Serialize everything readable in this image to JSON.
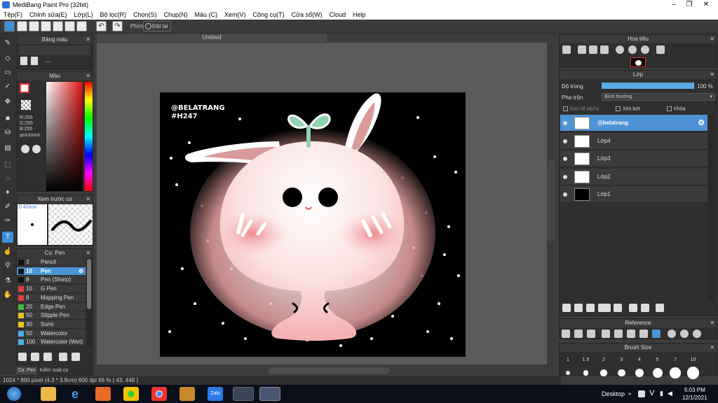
{
  "window": {
    "title": "MediBang Paint Pro (32bit)"
  },
  "menu": [
    "Tệp(F)",
    "Chỉnh sửa(E)",
    "Lớp(L)",
    "Bộ lọc(R)",
    "Chọn(S)",
    "Chụp(N)",
    "Màu (C)",
    "Xem(V)",
    "Công cụ(T)",
    "Cửa sổ(W)",
    "Cloud",
    "Help"
  ],
  "toolbar": {
    "key_label": "Phím",
    "reset_label": "Đặt lại"
  },
  "document": {
    "tab_title": "Untitled"
  },
  "panels": {
    "palette": {
      "title": "Bảng màu",
      "placeholder": "---"
    },
    "color": {
      "title": "Màu",
      "r": "R:255",
      "g": "G:255",
      "b": "B:255",
      "hex": "#FFFFFF"
    },
    "brush_preview": {
      "title": "Xem trước cọ",
      "size": "0.42mm"
    },
    "brush": {
      "title": "Cọ: Pen",
      "items": [
        {
          "size": "3",
          "name": "Pencil",
          "color": "#111111"
        },
        {
          "size": "10",
          "name": "Pen",
          "color": "#111111",
          "selected": true
        },
        {
          "size": "8",
          "name": "Pen (Sharp)",
          "color": "#111111"
        },
        {
          "size": "10",
          "name": "G Pen",
          "color": "#e53b3b"
        },
        {
          "size": "8",
          "name": "Mapping Pen",
          "color": "#e53b3b"
        },
        {
          "size": "20",
          "name": "Edge Pen",
          "color": "#3cbf3c"
        },
        {
          "size": "50",
          "name": "Stipple Pen",
          "color": "#e8c21f"
        },
        {
          "size": "30",
          "name": "Sumi",
          "color": "#e8c21f"
        },
        {
          "size": "50",
          "name": "Watercolor",
          "color": "#4bb0e6"
        },
        {
          "size": "100",
          "name": "Watercolor (Wet)",
          "color": "#4bb0e6"
        }
      ],
      "tabs": [
        "Cọ: Pen",
        "Kiểm soát cọ"
      ]
    },
    "navigator": {
      "title": "Hoa tiêu"
    },
    "layer": {
      "title": "Lớp",
      "opacity_label": "Độ trong",
      "opacity_value": "100 %",
      "opacity_fraction": 1.0,
      "blend_label": "Pha trộn",
      "blend_value": "Bình thường",
      "protect_alpha": "Bảo vệ alpha",
      "clip": "Xén bớt",
      "lock": "Khóa",
      "layers": [
        {
          "name": "@belatrang",
          "selected": true
        },
        {
          "name": "Lớp4"
        },
        {
          "name": "Lớp3"
        },
        {
          "name": "Lớp2"
        },
        {
          "name": "Lớp1"
        }
      ]
    },
    "reference": {
      "title": "Reference"
    },
    "brush_size": {
      "title": "Brush Size",
      "sizes": [
        "1",
        "1.5",
        "2",
        "3",
        "4",
        "5",
        "7",
        "10"
      ]
    }
  },
  "artwork": {
    "line1": "@BELATRANG",
    "line2": "#H247"
  },
  "status": {
    "text": "1024 * 890 pixel  (4.3 * 3.8cm)  600 dpi  66 %  ( 43, 448 )"
  },
  "taskbar": {
    "desktop_label": "Desktop",
    "language": "V",
    "time": "5:03 PM",
    "date": "12/1/2021"
  },
  "colors": {
    "accent": "#4d93d6",
    "bunny": "#ffffff",
    "ear_inner": "#d99a9a",
    "sprout": "#8fd4b0",
    "blush": "#f4a6a6"
  }
}
